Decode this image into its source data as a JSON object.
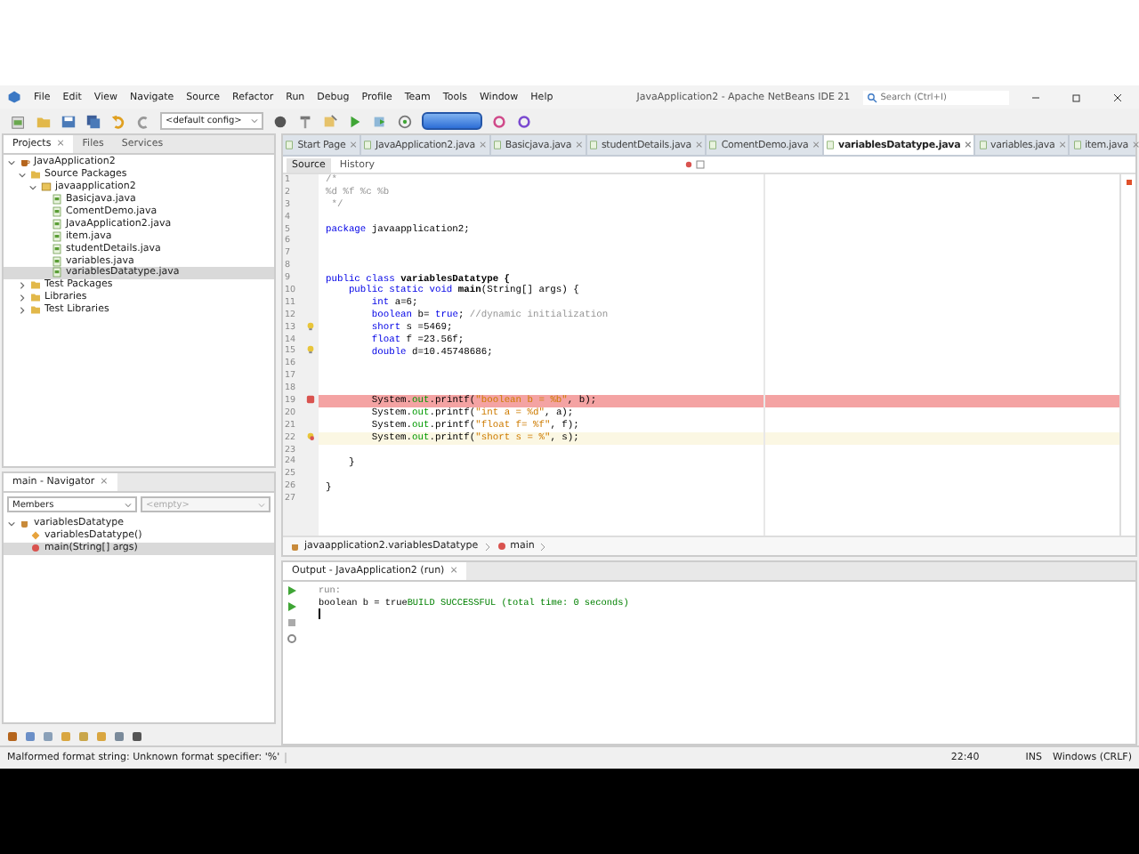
{
  "window": {
    "title": "JavaApplication2 - Apache NetBeans IDE 21",
    "search_placeholder": "Search (Ctrl+I)"
  },
  "menu": [
    "File",
    "Edit",
    "View",
    "Navigate",
    "Source",
    "Refactor",
    "Run",
    "Debug",
    "Profile",
    "Team",
    "Tools",
    "Window",
    "Help"
  ],
  "toolbar": {
    "config": "<default config>"
  },
  "left_tabs": [
    {
      "label": "Projects",
      "selected": true,
      "close": "×"
    },
    {
      "label": "Files",
      "selected": false
    },
    {
      "label": "Services",
      "selected": false
    }
  ],
  "project_tree": [
    {
      "label": "JavaApplication2",
      "kind": "project",
      "expanded": true,
      "selected": false,
      "children": [
        {
          "label": "Source Packages",
          "kind": "folder",
          "expanded": true,
          "selected": false,
          "children": [
            {
              "label": "javaapplication2",
              "kind": "package",
              "expanded": true,
              "selected": false,
              "children": [
                {
                  "label": "Basicjava.java",
                  "kind": "file",
                  "selected": false
                },
                {
                  "label": "ComentDemo.java",
                  "kind": "file",
                  "selected": false
                },
                {
                  "label": "JavaApplication2.java",
                  "kind": "file",
                  "selected": false
                },
                {
                  "label": "item.java",
                  "kind": "file",
                  "selected": false
                },
                {
                  "label": "studentDetails.java",
                  "kind": "file",
                  "selected": false
                },
                {
                  "label": "variables.java",
                  "kind": "file",
                  "selected": false
                },
                {
                  "label": "variablesDatatype.java",
                  "kind": "file",
                  "selected": true
                }
              ]
            }
          ]
        },
        {
          "label": "Test Packages",
          "kind": "folder",
          "expanded": false,
          "selected": false
        },
        {
          "label": "Libraries",
          "kind": "folder",
          "expanded": false,
          "selected": false
        },
        {
          "label": "Test Libraries",
          "kind": "folder",
          "expanded": false,
          "selected": false
        }
      ]
    }
  ],
  "navigator": {
    "title": "main - Navigator",
    "close": "×",
    "filter": "Members",
    "second_filter": "<empty>",
    "tree": [
      {
        "label": "variablesDatatype",
        "kind": "class",
        "expanded": true,
        "selected": false,
        "children": [
          {
            "label": "variablesDatatype()",
            "kind": "constructor",
            "selected": false
          },
          {
            "label": "main(String[] args)",
            "kind": "method",
            "selected": true
          }
        ]
      }
    ]
  },
  "editor_tabs": [
    {
      "label": "Start Page",
      "selected": false,
      "close": "×"
    },
    {
      "label": "JavaApplication2.java",
      "selected": false,
      "close": "×"
    },
    {
      "label": "Basicjava.java",
      "selected": false,
      "close": "×"
    },
    {
      "label": "studentDetails.java",
      "selected": false,
      "close": "×"
    },
    {
      "label": "ComentDemo.java",
      "selected": false,
      "close": "×"
    },
    {
      "label": "variablesDatatype.java",
      "selected": true,
      "close": "×"
    },
    {
      "label": "variables.java",
      "selected": false,
      "close": "×"
    },
    {
      "label": "item.java",
      "selected": false,
      "close": "×"
    }
  ],
  "editor_modes": [
    {
      "label": "Source",
      "selected": true
    },
    {
      "label": "History",
      "selected": false
    }
  ],
  "code": [
    {
      "number": "1",
      "error": false,
      "current": false,
      "hint": false,
      "tokens": [
        {
          "text": "/*",
          "kind": "comment"
        }
      ]
    },
    {
      "number": "2",
      "error": false,
      "current": false,
      "hint": false,
      "tokens": [
        {
          "text": "%d %f %c %b",
          "kind": "comment"
        }
      ]
    },
    {
      "number": "3",
      "error": false,
      "current": false,
      "hint": false,
      "tokens": [
        {
          "text": " */",
          "kind": "comment"
        }
      ]
    },
    {
      "number": "4",
      "error": false,
      "current": false,
      "hint": false
    },
    {
      "number": "5",
      "error": false,
      "current": false,
      "hint": false,
      "tokens": [
        {
          "text": "package",
          "kind": "keyword"
        },
        {
          "text": " javaapplication2;",
          "kind": "plain"
        }
      ]
    },
    {
      "number": "6",
      "error": false,
      "current": false,
      "hint": false
    },
    {
      "number": "7",
      "error": false,
      "current": false,
      "hint": false
    },
    {
      "number": "8",
      "error": false,
      "current": false,
      "hint": false
    },
    {
      "number": "9",
      "error": false,
      "current": false,
      "hint": false,
      "tokens": [
        {
          "text": "public class",
          "kind": "keyword"
        },
        {
          "text": " variablesDatatype {",
          "kind": "bold"
        }
      ]
    },
    {
      "number": "10",
      "error": false,
      "current": false,
      "hint": false,
      "tokens": [
        {
          "text": "    public static void",
          "kind": "keyword"
        },
        {
          "text": " main",
          "kind": "bold"
        },
        {
          "text": "(String[] args) {",
          "kind": "plain"
        }
      ]
    },
    {
      "number": "11",
      "error": false,
      "current": false,
      "hint": false,
      "tokens": [
        {
          "text": "        int",
          "kind": "keyword"
        },
        {
          "text": " a=6;",
          "kind": "plain"
        }
      ]
    },
    {
      "number": "12",
      "error": false,
      "current": false,
      "hint": false,
      "tokens": [
        {
          "text": "        boolean",
          "kind": "keyword"
        },
        {
          "text": " b= ",
          "kind": "plain"
        },
        {
          "text": "true",
          "kind": "keyword"
        },
        {
          "text": "; ",
          "kind": "plain"
        },
        {
          "text": "//dynamic initialization",
          "kind": "comment"
        }
      ]
    },
    {
      "number": "13",
      "error": false,
      "current": false,
      "hint": true,
      "tokens": [
        {
          "text": "        short",
          "kind": "keyword"
        },
        {
          "text": " s =5469;",
          "kind": "plain"
        }
      ]
    },
    {
      "number": "14",
      "error": false,
      "current": false,
      "hint": false,
      "tokens": [
        {
          "text": "        float",
          "kind": "keyword"
        },
        {
          "text": " f =23.56f;",
          "kind": "plain"
        }
      ]
    },
    {
      "number": "15",
      "error": false,
      "current": false,
      "hint": true,
      "tokens": [
        {
          "text": "        double",
          "kind": "keyword"
        },
        {
          "text": " d=10.45748686;",
          "kind": "plain"
        }
      ]
    },
    {
      "number": "16",
      "error": false,
      "current": false,
      "hint": false
    },
    {
      "number": "17",
      "error": false,
      "current": false,
      "hint": false
    },
    {
      "number": "18",
      "error": false,
      "current": false,
      "hint": false
    },
    {
      "number": "19",
      "error": true,
      "current": false,
      "hint": false,
      "tokens": [
        {
          "text": "        System.",
          "kind": "plain"
        },
        {
          "text": "out",
          "kind": "field"
        },
        {
          "text": ".printf(",
          "kind": "plain"
        },
        {
          "text": "\"boolean b = %b\"",
          "kind": "string"
        },
        {
          "text": ", b);",
          "kind": "plain"
        }
      ]
    },
    {
      "number": "20",
      "error": false,
      "current": false,
      "hint": false,
      "tokens": [
        {
          "text": "        System.",
          "kind": "plain"
        },
        {
          "text": "out",
          "kind": "field"
        },
        {
          "text": ".printf(",
          "kind": "plain"
        },
        {
          "text": "\"int a = %d\"",
          "kind": "string"
        },
        {
          "text": ", a);",
          "kind": "plain"
        }
      ]
    },
    {
      "number": "21",
      "error": false,
      "current": false,
      "hint": false,
      "tokens": [
        {
          "text": "        System.",
          "kind": "plain"
        },
        {
          "text": "out",
          "kind": "field"
        },
        {
          "text": ".printf(",
          "kind": "plain"
        },
        {
          "text": "\"float f= %f\"",
          "kind": "string"
        },
        {
          "text": ", f);",
          "kind": "plain"
        }
      ]
    },
    {
      "number": "22",
      "error": false,
      "current": true,
      "hint": true,
      "tokens": [
        {
          "text": "        System.",
          "kind": "plain"
        },
        {
          "text": "out",
          "kind": "field"
        },
        {
          "text": ".printf(",
          "kind": "plain"
        },
        {
          "text": "\"short s = %\"",
          "kind": "string"
        },
        {
          "text": ", s);",
          "kind": "plain"
        }
      ]
    },
    {
      "number": "23",
      "error": false,
      "current": false,
      "hint": false
    },
    {
      "number": "24",
      "error": false,
      "current": false,
      "hint": false,
      "tokens": [
        {
          "text": "    }",
          "kind": "plain"
        }
      ]
    },
    {
      "number": "25",
      "error": false,
      "current": false,
      "hint": false
    },
    {
      "number": "26",
      "error": false,
      "current": false,
      "hint": false,
      "tokens": [
        {
          "text": "}",
          "kind": "plain"
        }
      ]
    },
    {
      "number": "27",
      "error": false,
      "current": false,
      "hint": false
    }
  ],
  "breadcrumbs": [
    "javaapplication2.variablesDatatype",
    "main"
  ],
  "output": {
    "title": "Output - JavaApplication2 (run)",
    "close": "×",
    "lines": [
      {
        "tokens": [
          {
            "text": "run:",
            "kind": "info"
          }
        ]
      },
      {
        "tokens": [
          {
            "text": "boolean b = true",
            "kind": "plain"
          },
          {
            "text": "BUILD SUCCESSFUL (total time: 0 seconds)",
            "kind": "success"
          }
        ]
      }
    ]
  },
  "status_bar": {
    "message": "Malformed format string: Unknown format specifier: '%'",
    "position": "22:40",
    "mode": "INS",
    "line_ending": "Windows (CRLF)"
  }
}
